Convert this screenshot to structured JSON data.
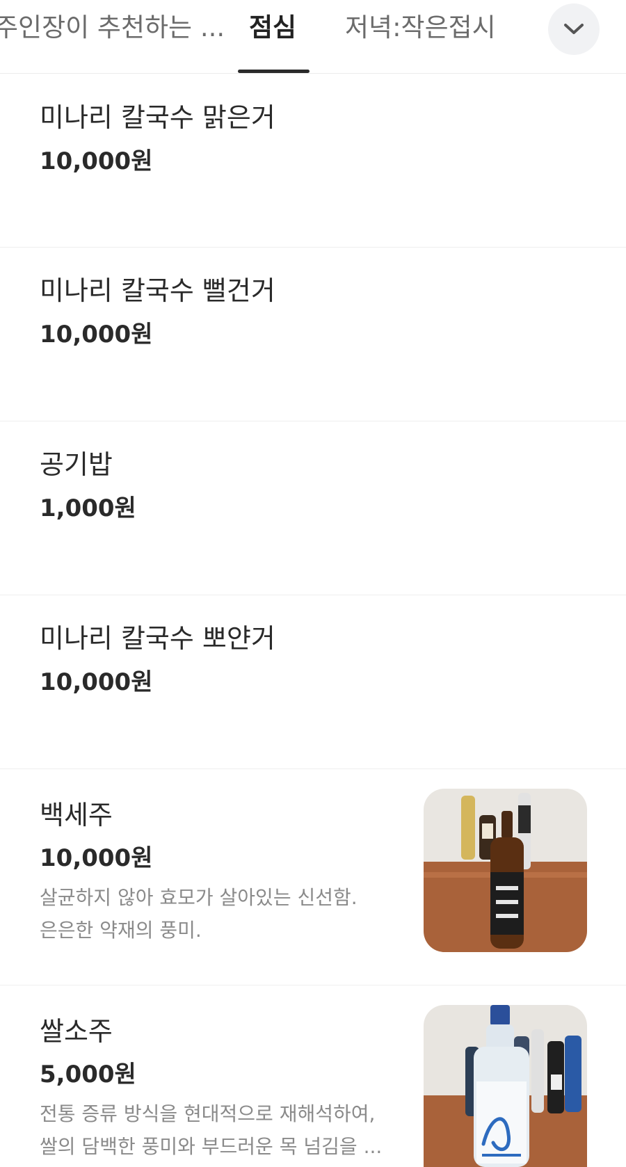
{
  "tabs": [
    {
      "label": "주인장이 추천하는 ..."
    },
    {
      "label": "점심"
    },
    {
      "label": "저녁:작은접시"
    }
  ],
  "menu": [
    {
      "name": "미나리 칼국수 맑은거",
      "price": "10,000원"
    },
    {
      "name": "미나리 칼국수 뻘건거",
      "price": "10,000원"
    },
    {
      "name": "공기밥",
      "price": "1,000원"
    },
    {
      "name": "미나리 칼국수 뽀얀거",
      "price": "10,000원"
    },
    {
      "name": "백세주",
      "price": "10,000원",
      "desc": [
        "살균하지 않아 효모가 살아있는 신선함.",
        "은은한 약재의 풍미."
      ]
    },
    {
      "name": "쌀소주",
      "price": "5,000원",
      "desc": [
        "전통 증류 방식을 현대적으로 재해석하여,",
        "쌀의 담백한 풍미와 부드러운 목 넘김을 ..."
      ]
    }
  ],
  "icons": {
    "dropdown": "chevron-down-icon"
  },
  "colors": {
    "active_tab": "#222222",
    "inactive_tab": "#6b6b6b",
    "price": "#2a2a2a",
    "desc": "#8a8a8a"
  }
}
